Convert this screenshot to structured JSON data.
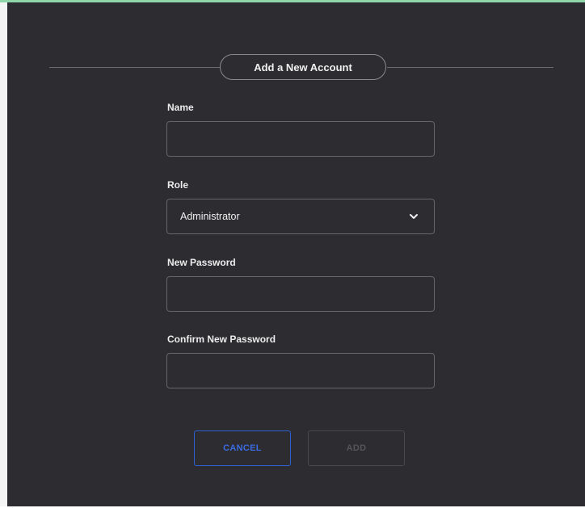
{
  "dialog": {
    "title": "Add a New Account"
  },
  "fields": {
    "name": {
      "label": "Name",
      "value": ""
    },
    "role": {
      "label": "Role",
      "value": "Administrator"
    },
    "new_password": {
      "label": "New Password",
      "value": ""
    },
    "confirm_password": {
      "label": "Confirm New Password",
      "value": ""
    }
  },
  "buttons": {
    "cancel": "CANCEL",
    "add": "ADD"
  },
  "colors": {
    "panel_bg": "#2c2c31",
    "accent_blue": "#3a6be0",
    "top_border": "#8fd6a8"
  },
  "icons": {
    "role_dropdown": "chevron-down-icon"
  }
}
